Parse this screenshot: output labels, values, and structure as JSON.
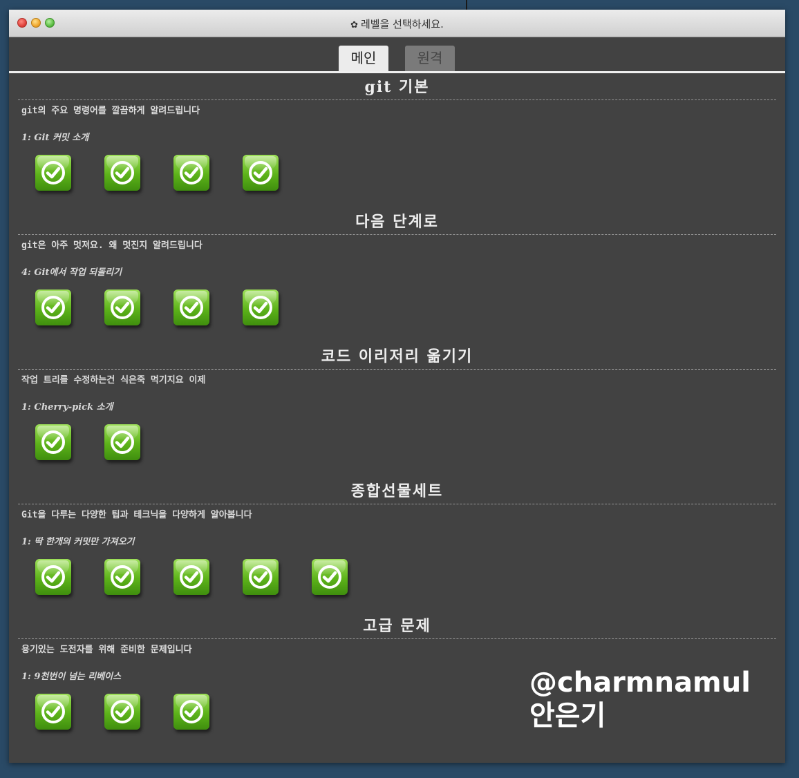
{
  "window": {
    "title": "레벨을 선택하세요.",
    "title_icon": "gear-icon"
  },
  "tabs": [
    {
      "label": "메인",
      "active": true
    },
    {
      "label": "원격",
      "active": false
    }
  ],
  "sections": [
    {
      "title": "git 기본",
      "description": "git의 주요 명령어를 깔끔하게 알려드립니다",
      "next_level": "1: Git 커밋 소개",
      "levels": [
        {
          "status": "completed",
          "icon": "check-icon"
        },
        {
          "status": "completed",
          "icon": "check-icon"
        },
        {
          "status": "completed",
          "icon": "check-icon"
        },
        {
          "status": "completed",
          "icon": "check-icon"
        }
      ]
    },
    {
      "title": "다음 단계로",
      "description": "git은 아주 멋져요. 왜 멋진지 알려드립니다",
      "next_level": "4: Git에서 작업 되돌리기",
      "levels": [
        {
          "status": "completed",
          "icon": "check-icon"
        },
        {
          "status": "completed",
          "icon": "check-icon"
        },
        {
          "status": "completed",
          "icon": "check-icon"
        },
        {
          "status": "completed",
          "icon": "check-icon"
        }
      ]
    },
    {
      "title": "코드 이리저리 옮기기",
      "description": "작업 트리를 수정하는건 식은죽 먹기지요 이제",
      "next_level": "1: Cherry-pick 소개",
      "levels": [
        {
          "status": "completed",
          "icon": "check-icon"
        },
        {
          "status": "completed",
          "icon": "check-icon"
        }
      ]
    },
    {
      "title": "종합선물세트",
      "description": "Git을 다루는 다양한 팁과 테크닉을 다양하게 알아봅니다",
      "next_level": "1: 딱 한개의 커밋만 가져오기",
      "levels": [
        {
          "status": "completed",
          "icon": "check-icon"
        },
        {
          "status": "completed",
          "icon": "check-icon"
        },
        {
          "status": "completed",
          "icon": "check-icon"
        },
        {
          "status": "completed",
          "icon": "check-icon"
        },
        {
          "status": "completed",
          "icon": "check-icon"
        }
      ]
    },
    {
      "title": "고급 문제",
      "description": "용기있는 도전자를 위해 준비한 문제입니다",
      "next_level": "1: 9천번이 넘는 리베이스",
      "levels": [
        {
          "status": "completed",
          "icon": "check-icon"
        },
        {
          "status": "completed",
          "icon": "check-icon"
        },
        {
          "status": "completed",
          "icon": "check-icon"
        }
      ]
    }
  ],
  "watermark": {
    "handle": "@charmnamul",
    "name": "안은기"
  },
  "colors": {
    "panel_bg": "#424242",
    "level_complete": "#6cc022",
    "desktop_bg": "#2a4a66"
  }
}
